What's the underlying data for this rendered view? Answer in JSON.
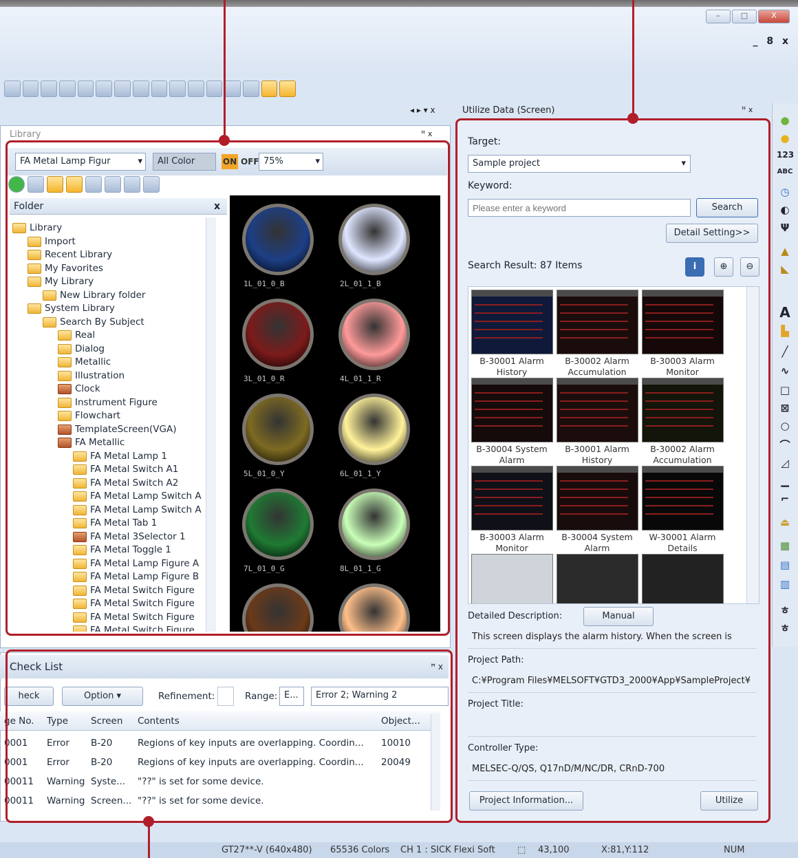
{
  "window": {
    "min": "–",
    "restore": "□",
    "close": "X",
    "mdi_controls": "_ 8 x"
  },
  "library": {
    "title": "Library",
    "pin": "ꟸ x",
    "category": "FA Metal Lamp Figur",
    "color_filter": "All Color",
    "on_label": "ON",
    "off_label": "OFF",
    "zoom": "75%",
    "folder_header": "Folder",
    "folder_close": "x",
    "tree": [
      {
        "label": "Library",
        "indent": 0,
        "kind": "lib"
      },
      {
        "label": "Import",
        "indent": 1,
        "kind": "import"
      },
      {
        "label": "Recent Library",
        "indent": 1,
        "kind": "folder"
      },
      {
        "label": "My Favorites",
        "indent": 1,
        "kind": "folder"
      },
      {
        "label": "My Library",
        "indent": 1,
        "kind": "folder"
      },
      {
        "label": "New Library folder",
        "indent": 2,
        "kind": "folder"
      },
      {
        "label": "System Library",
        "indent": 1,
        "kind": "folder"
      },
      {
        "label": "Search By Subject",
        "indent": 2,
        "kind": "folder"
      },
      {
        "label": "Real",
        "indent": 3,
        "kind": "folder"
      },
      {
        "label": "Dialog",
        "indent": 3,
        "kind": "folder"
      },
      {
        "label": "Metallic",
        "indent": 3,
        "kind": "folder"
      },
      {
        "label": "Illustration",
        "indent": 3,
        "kind": "folder"
      },
      {
        "label": "Clock",
        "indent": 3,
        "kind": "red"
      },
      {
        "label": "Instrument Figure",
        "indent": 3,
        "kind": "folder"
      },
      {
        "label": "Flowchart",
        "indent": 3,
        "kind": "folder"
      },
      {
        "label": "TemplateScreen(VGA)",
        "indent": 3,
        "kind": "red"
      },
      {
        "label": "FA Metallic",
        "indent": 3,
        "kind": "red"
      },
      {
        "label": "FA Metal Lamp 1",
        "indent": 4,
        "kind": "folder"
      },
      {
        "label": "FA Metal Switch A1",
        "indent": 4,
        "kind": "folder"
      },
      {
        "label": "FA Metal Switch A2",
        "indent": 4,
        "kind": "folder"
      },
      {
        "label": "FA Metal Lamp Switch A",
        "indent": 4,
        "kind": "folder"
      },
      {
        "label": "FA Metal Lamp Switch A",
        "indent": 4,
        "kind": "folder"
      },
      {
        "label": "FA Metal Tab 1",
        "indent": 4,
        "kind": "folder"
      },
      {
        "label": "FA Metal 3Selector 1",
        "indent": 4,
        "kind": "red"
      },
      {
        "label": "FA Metal Toggle 1",
        "indent": 4,
        "kind": "folder"
      },
      {
        "label": "FA Metal Lamp Figure A",
        "indent": 4,
        "kind": "folder"
      },
      {
        "label": "FA Metal Lamp Figure B",
        "indent": 4,
        "kind": "folder"
      },
      {
        "label": "FA Metal Switch Figure",
        "indent": 4,
        "kind": "folder"
      },
      {
        "label": "FA Metal Switch Figure",
        "indent": 4,
        "kind": "folder"
      },
      {
        "label": "FA Metal Switch Figure",
        "indent": 4,
        "kind": "folder"
      },
      {
        "label": "FA Metal Switch Figure",
        "indent": 4,
        "kind": "folder"
      }
    ],
    "lamps": [
      {
        "label": "1L_01_0_B",
        "color": "#1d3f86"
      },
      {
        "label": "2L_01_1_B",
        "color": "#dfe6ff"
      },
      {
        "label": "3L_01_0_R",
        "color": "#7c1b1b"
      },
      {
        "label": "4L_01_1_R",
        "color": "#ff9a9a"
      },
      {
        "label": "5L_01_0_Y",
        "color": "#7d6a22"
      },
      {
        "label": "6L_01_1_Y",
        "color": "#fff29a"
      },
      {
        "label": "7L_01_0_G",
        "color": "#1f7a33"
      },
      {
        "label": "8L_01_1_G",
        "color": "#c9ffb8"
      },
      {
        "label": "",
        "color": "#6b3a1a"
      },
      {
        "label": "",
        "color": "#ffc08a"
      }
    ]
  },
  "utilize": {
    "title": "Utilize Data (Screen)",
    "pin": "ꟸ x",
    "target_label": "Target:",
    "target_value": "Sample project",
    "keyword_label": "Keyword:",
    "keyword_placeholder": "Please enter a keyword",
    "search_btn": "Search",
    "detail_btn": "Detail Setting>>",
    "result_label": "Search Result: 87 Items",
    "thumbs": [
      {
        "l1": "B-30001 Alarm",
        "l2": "History"
      },
      {
        "l1": "B-30002 Alarm",
        "l2": "Accumulation"
      },
      {
        "l1": "B-30003 Alarm",
        "l2": "Monitor"
      },
      {
        "l1": "B-30004 System",
        "l2": "Alarm"
      },
      {
        "l1": "B-30001 Alarm",
        "l2": "History"
      },
      {
        "l1": "B-30002 Alarm",
        "l2": "Accumulation"
      },
      {
        "l1": "B-30003 Alarm",
        "l2": "Monitor"
      },
      {
        "l1": "B-30004 System",
        "l2": "Alarm"
      },
      {
        "l1": "W-30001 Alarm",
        "l2": "Details"
      }
    ],
    "desc_label": "Detailed Description:",
    "manual_btn": "Manual",
    "desc_text": "This screen displays the alarm history. When the screen is",
    "path_label": "Project Path:",
    "path_value": "C:¥Program Files¥MELSOFT¥GTD3_2000¥App¥SampleProject¥",
    "ptitle_label": "Project Title:",
    "ptitle_value": "",
    "ctype_label": "Controller Type:",
    "ctype_value": "MELSEC-Q/QS, Q17nD/M/NC/DR, CRnD-700",
    "info_btn": "Project Information...",
    "utilize_btn": "Utilize"
  },
  "checklist": {
    "title": "Check List",
    "pin": "ꟸ x",
    "check_btn": "heck",
    "option_btn": "Option",
    "refine_label": "Refinement:",
    "range_label": "Range:",
    "range_value": "E...",
    "summary": "Error 2; Warning 2",
    "columns": [
      "ge No.",
      "Type",
      "Screen",
      "Contents",
      "Object..."
    ],
    "rows": [
      [
        "0001",
        "Error",
        "B-20",
        "Regions of key inputs are overlapping. Coordin...",
        "10010"
      ],
      [
        "0001",
        "Error",
        "B-20",
        "Regions of key inputs are overlapping. Coordin...",
        "20049"
      ],
      [
        "00011",
        "Warning",
        "Syste...",
        "\"??\" is set for some device.",
        ""
      ],
      [
        "00011",
        "Warning",
        "Screen...",
        "\"??\" is set for some device.",
        ""
      ]
    ]
  },
  "status": {
    "device": "GT27**-V (640x480)",
    "colors": "65536 Colors",
    "channel": "CH 1 : SICK Flexi Soft",
    "size": "43,100",
    "coords": "X:81,Y:112",
    "num": "NUM"
  },
  "colors": {
    "callout": "#b01e2a",
    "accent": "#3a6db3"
  }
}
